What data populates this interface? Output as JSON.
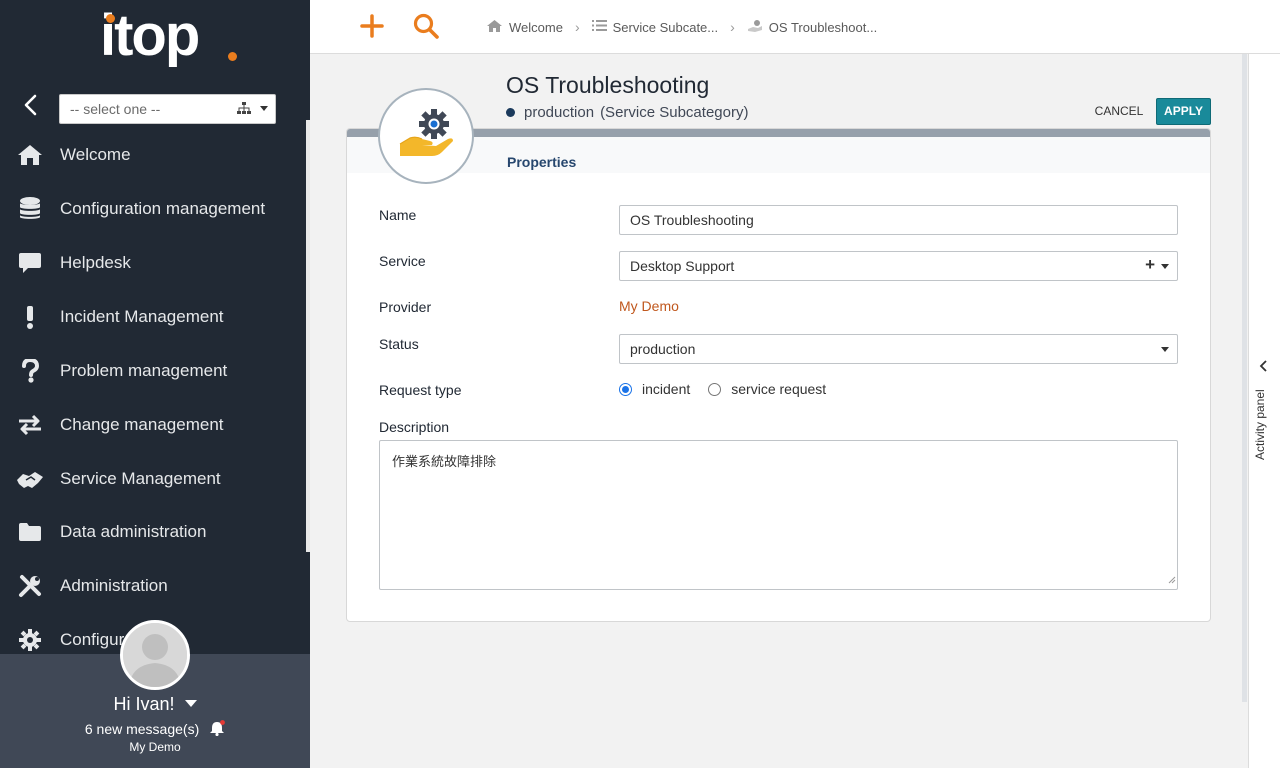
{
  "sidebar": {
    "logo_text": "itop",
    "org_select": {
      "value": "-- select one --"
    },
    "menu": [
      {
        "id": "welcome",
        "label": "Welcome",
        "icon": "home-icon"
      },
      {
        "id": "configuration",
        "label": "Configuration management",
        "icon": "database-icon"
      },
      {
        "id": "helpdesk",
        "label": "Helpdesk",
        "icon": "chat-bubble-icon"
      },
      {
        "id": "incident",
        "label": "Incident Management",
        "icon": "exclamation-icon"
      },
      {
        "id": "problem",
        "label": "Problem management",
        "icon": "question-icon"
      },
      {
        "id": "change",
        "label": "Change management",
        "icon": "exchange-arrows-icon"
      },
      {
        "id": "service",
        "label": "Service Management",
        "icon": "handshake-icon"
      },
      {
        "id": "data-admin",
        "label": "Data administration",
        "icon": "folder-icon"
      },
      {
        "id": "administration",
        "label": "Administration",
        "icon": "tools-icon"
      },
      {
        "id": "configuration2",
        "label": "Configura",
        "icon": "gear-icon"
      }
    ],
    "user": {
      "greeting": "Hi Ivan!",
      "messages": "6 new message(s)",
      "organization": "My Demo"
    }
  },
  "topbar": {
    "breadcrumb": [
      {
        "label": "Welcome",
        "icon": "home-icon"
      },
      {
        "label": "Service Subcate...",
        "icon": "list-icon"
      },
      {
        "label": "OS Troubleshoot...",
        "icon": "service-subcategory-icon"
      }
    ]
  },
  "object": {
    "title": "OS Troubleshooting",
    "status": "production",
    "class": "(Service Subcategory)",
    "cancel_label": "CANCEL",
    "apply_label": "APPLY",
    "tab": "Properties",
    "fields": {
      "name": {
        "label": "Name",
        "value": "OS Troubleshooting"
      },
      "service": {
        "label": "Service",
        "value": "Desktop Support"
      },
      "provider": {
        "label": "Provider",
        "value": "My Demo"
      },
      "status": {
        "label": "Status",
        "value": "production"
      },
      "request_type": {
        "label": "Request type",
        "options": [
          "incident",
          "service request"
        ],
        "selected": "incident"
      },
      "description": {
        "label": "Description",
        "value": "作業系統故障排除"
      }
    }
  },
  "activity_panel": {
    "label": "Activity panel"
  },
  "colors": {
    "sidebar_bg": "#212934",
    "accent_orange": "#ea7d1e",
    "apply_teal": "#198a9a",
    "link_orange": "#c0581e",
    "status_navy": "#1b3a5c"
  }
}
